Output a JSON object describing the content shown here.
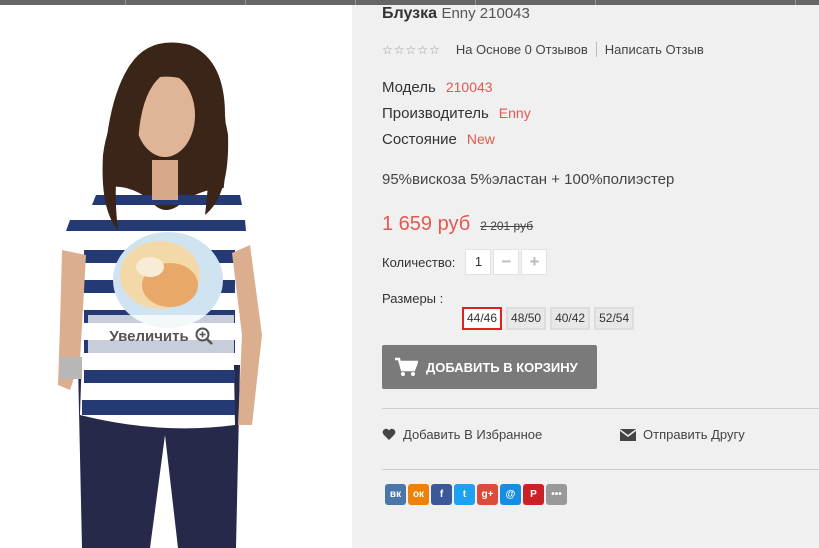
{
  "product": {
    "name": "Блузка",
    "subtitle": "Enny 210043",
    "reviews_text": "На Основе 0 Отзывов",
    "write_review": "Написать Отзыв",
    "specs": [
      {
        "label": "Модель",
        "value": "210043"
      },
      {
        "label": "Производитель",
        "value": "Enny"
      },
      {
        "label": "Состояние",
        "value": "New"
      }
    ],
    "composition": "95%вискоза 5%эластан + 100%полиэстер",
    "price": "1 659 руб",
    "old_price": "2 201 руб",
    "quantity_label": "Количество:",
    "quantity_value": "1",
    "sizes_label": "Размеры :",
    "sizes": [
      "44/46",
      "48/50",
      "40/42",
      "52/54"
    ],
    "selected_size": "44/46",
    "add_to_cart": "ДОБАВИТЬ В КОРЗИНУ",
    "add_to_wishlist": "Добавить В Избранное",
    "send_to_friend": "Отправить Другу"
  },
  "image": {
    "zoom_label": "Увеличить"
  },
  "share": [
    {
      "icon": "vkontakte-icon",
      "glyph": "вк",
      "color": "#4a76a8"
    },
    {
      "icon": "odnoklassniki-icon",
      "glyph": "ок",
      "color": "#ee8208"
    },
    {
      "icon": "facebook-icon",
      "glyph": "f",
      "color": "#3b5998"
    },
    {
      "icon": "twitter-icon",
      "glyph": "t",
      "color": "#1da1f2"
    },
    {
      "icon": "google-plus-icon",
      "glyph": "g+",
      "color": "#dd4b39"
    },
    {
      "icon": "mail-ru-icon",
      "glyph": "@",
      "color": "#168de2"
    },
    {
      "icon": "pinterest-icon",
      "glyph": "P",
      "color": "#cb2027"
    },
    {
      "icon": "more-icon",
      "glyph": "•••",
      "color": "#999999"
    }
  ],
  "colors": {
    "accent": "#e05a4f",
    "button": "#7a7a7a",
    "selected_border": "#dd2222"
  }
}
